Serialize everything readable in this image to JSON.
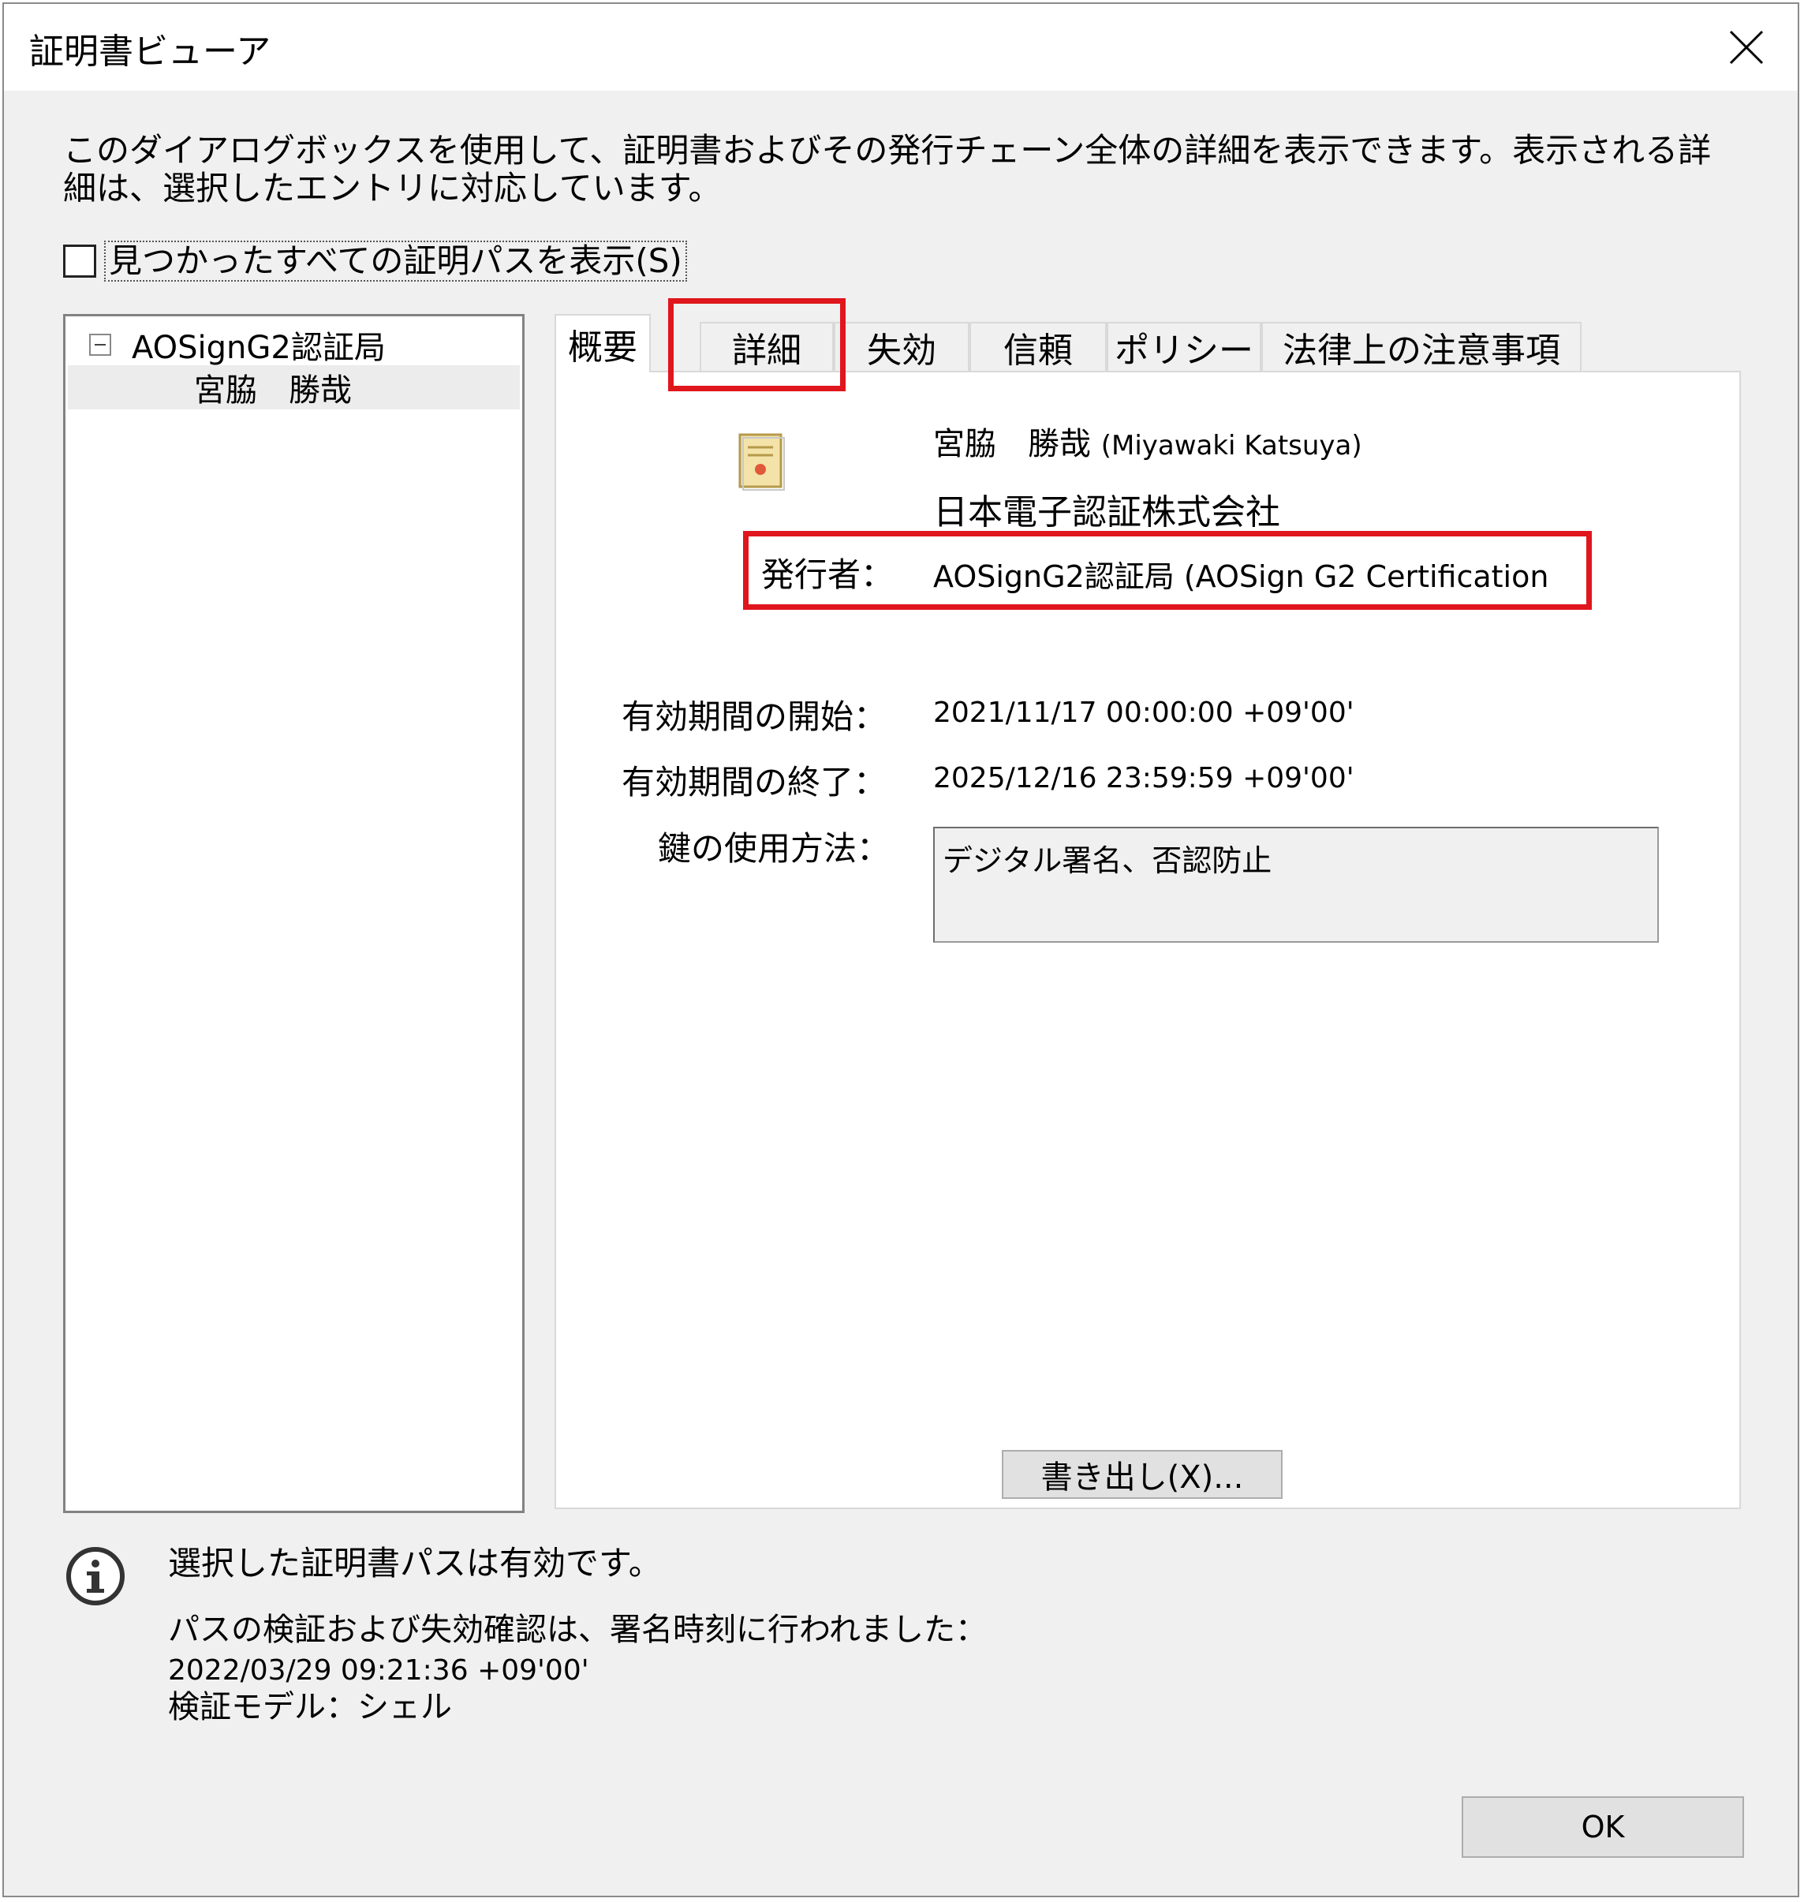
{
  "window": {
    "title": "証明書ビューア",
    "description": "このダイアログボックスを使用して、証明書およびその発行チェーン全体の詳細を表示できます。表示される詳細は、選択したエントリに対応しています。",
    "show_all_paths_label": "見つかったすべての証明パスを表示(S)"
  },
  "tree": {
    "root_label": "AOSignG2認証局",
    "child_label": "宮脇　勝哉"
  },
  "tabs": [
    {
      "label": "概要"
    },
    {
      "label": "詳細"
    },
    {
      "label": "失効"
    },
    {
      "label": "信頼"
    },
    {
      "label": "ポリシー"
    },
    {
      "label": "法律上の注意事項"
    }
  ],
  "summary": {
    "subject_name": "宮脇　勝哉",
    "subject_name_en": "(Miyawaki Katsuya)",
    "organization": "日本電子認証株式会社",
    "issuer_label": "発行者：",
    "issuer_value": "AOSignG2認証局 (AOSign G2 Certification",
    "valid_from_label": "有効期間の開始：",
    "valid_from_value": "2021/11/17 00:00:00 +09'00'",
    "valid_to_label": "有効期間の終了：",
    "valid_to_value": "2025/12/16 23:59:59 +09'00'",
    "key_usage_label": "鍵の使用方法：",
    "key_usage_value": "デジタル署名、否認防止",
    "export_label": "書き出し(X)..."
  },
  "status": {
    "valid_text": "選択した証明書パスは有効です。",
    "check_line1": "パスの検証および失効確認は、署名時刻に行われました：",
    "check_line2": "2022/03/29 09:21:36 +09'00'",
    "check_line3": "検証モデル：シェル"
  },
  "ok_label": "OK",
  "colors": {
    "highlight": "#e0161d",
    "dialog_bg": "#f0f0f0"
  }
}
